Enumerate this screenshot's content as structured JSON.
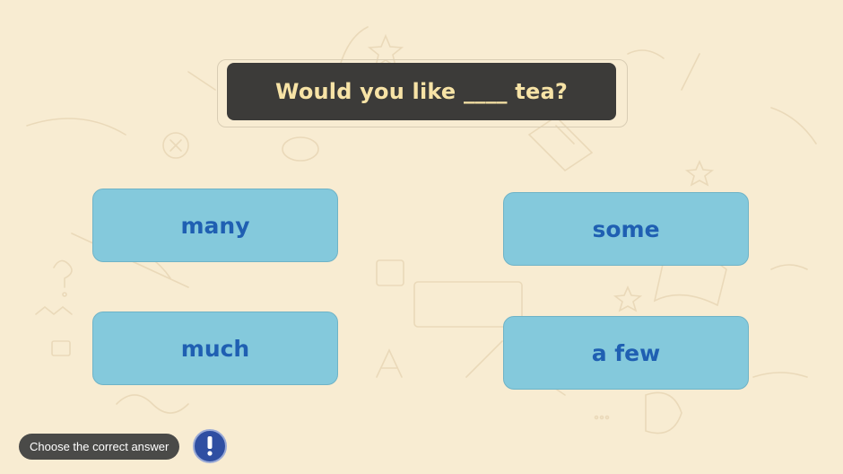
{
  "question": {
    "text": "Would you like ____ tea?"
  },
  "answers": [
    {
      "label": "many"
    },
    {
      "label": "some"
    },
    {
      "label": "much"
    },
    {
      "label": "a few"
    }
  ],
  "footer": {
    "instruction": "Choose the correct answer",
    "hint_icon": "exclamation-icon"
  },
  "colors": {
    "background": "#f8ecd2",
    "question_bg": "#3c3b39",
    "question_text": "#f7e3a6",
    "answer_bg": "#84c9dc",
    "answer_text": "#1f5fb2",
    "hint_button": "#2f4fa2"
  }
}
